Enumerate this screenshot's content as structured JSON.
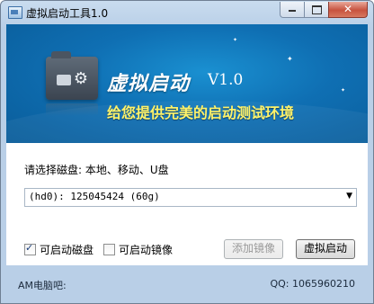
{
  "window": {
    "title": "虚拟启动工具1.0",
    "accent_color": "#0f6fb3",
    "slogan_color": "#fff36a"
  },
  "banner": {
    "brand_text": "虚拟启动",
    "version": "V1.0",
    "slogan": "给您提供完美的启动测试环境",
    "icon": "folder-gear-icon"
  },
  "disk": {
    "label": "请选择磁盘: 本地、移动、U盘",
    "selected": "(hd0): 125045424 (60g)"
  },
  "options": {
    "bootable_disk": {
      "label": "可启动磁盘",
      "checked": true
    },
    "bootable_image": {
      "label": "可启动镜像",
      "checked": false
    }
  },
  "buttons": {
    "add_image": "添加镜像",
    "virtual_boot": "虚拟启动"
  },
  "status": {
    "left": "AM电脑吧:",
    "right": "QQ: 1065960210"
  }
}
